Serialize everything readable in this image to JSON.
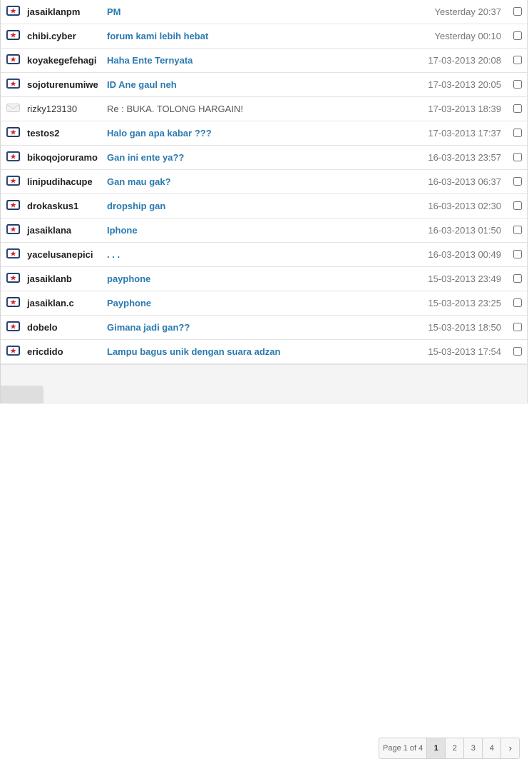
{
  "messages": [
    {
      "sender": "jasaiklanpm",
      "subject": "PM",
      "date": "Yesterday 20:37",
      "read": false
    },
    {
      "sender": "chibi.cyber",
      "subject": "forum kami lebih hebat",
      "date": "Yesterday 00:10",
      "read": false
    },
    {
      "sender": "koyakegefehagi",
      "subject": "Haha Ente Ternyata",
      "date": "17-03-2013 20:08",
      "read": false
    },
    {
      "sender": "sojoturenumiwe",
      "subject": "ID Ane gaul neh",
      "date": "17-03-2013 20:05",
      "read": false
    },
    {
      "sender": "rizky123130",
      "subject": "Re : BUKA. TOLONG HARGAIN!",
      "date": "17-03-2013 18:39",
      "read": true
    },
    {
      "sender": "testos2",
      "subject": "Halo gan apa kabar ???",
      "date": "17-03-2013 17:37",
      "read": false
    },
    {
      "sender": "bikoqojoruramo",
      "subject": "Gan ini ente ya??",
      "date": "16-03-2013 23:57",
      "read": false
    },
    {
      "sender": "linipudihacupe",
      "subject": "Gan mau gak?",
      "date": "16-03-2013 06:37",
      "read": false
    },
    {
      "sender": "drokaskus1",
      "subject": "dropship gan",
      "date": "16-03-2013 02:30",
      "read": false
    },
    {
      "sender": "jasaiklana",
      "subject": "Iphone",
      "date": "16-03-2013 01:50",
      "read": false
    },
    {
      "sender": "yacelusanepici",
      "subject": ". . .",
      "date": "16-03-2013 00:49",
      "read": false
    },
    {
      "sender": "jasaiklanb",
      "subject": "payphone",
      "date": "15-03-2013 23:49",
      "read": false
    },
    {
      "sender": "jasaiklan.c",
      "subject": "Payphone",
      "date": "15-03-2013 23:25",
      "read": false
    },
    {
      "sender": "dobelo",
      "subject": "Gimana jadi gan??",
      "date": "15-03-2013 18:50",
      "read": false
    },
    {
      "sender": "ericdido",
      "subject": "Lampu bagus unik dengan suara adzan",
      "date": "15-03-2013 17:54",
      "read": false
    }
  ],
  "icons": {
    "unread": "unread-message-icon",
    "read": "read-message-icon"
  },
  "colors": {
    "subject_link": "#2a7ab0",
    "unread_icon_red": "#d8232a",
    "unread_icon_blue": "#2f4f86"
  },
  "pagination": {
    "info": "Page 1 of 4",
    "pages": [
      "1",
      "2",
      "3",
      "4"
    ],
    "current": "1",
    "next_label": "›"
  }
}
